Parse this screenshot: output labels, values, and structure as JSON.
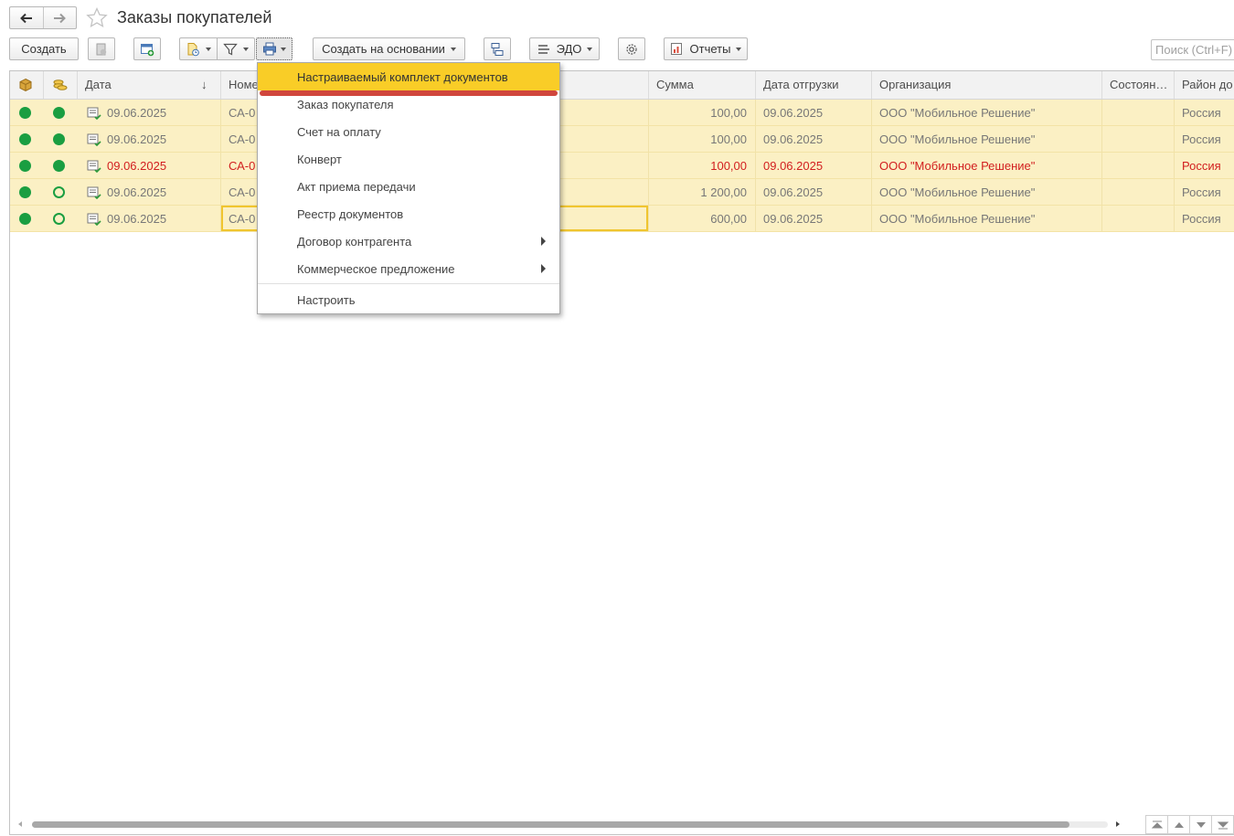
{
  "header": {
    "title": "Заказы покупателей",
    "back_icon": "arrow-left-icon",
    "forward_icon": "arrow-right-icon",
    "favorite_icon": "star-icon"
  },
  "toolbar": {
    "create_label": "Создать",
    "create_based_label": "Создать на основании",
    "edo_label": "ЭДО",
    "reports_label": "Отчеты",
    "search_placeholder": "Поиск (Ctrl+F)"
  },
  "columns": {
    "date": "Дата",
    "number": "Номе",
    "sum": "Сумма",
    "ship_date": "Дата отгрузки",
    "org": "Организация",
    "state": "Состоян…",
    "region": "Район до"
  },
  "sort_indicator": "↓",
  "rows": [
    {
      "status1": "full",
      "status2": "full",
      "date": "09.06.2025",
      "number": "СА-0",
      "sum": "100,00",
      "ship_date": "09.06.2025",
      "org": "ООО \"Мобильное Решение\"",
      "region": "Россия",
      "highlight": false
    },
    {
      "status1": "full",
      "status2": "full",
      "date": "09.06.2025",
      "number": "СА-0",
      "sum": "100,00",
      "ship_date": "09.06.2025",
      "org": "ООО \"Мобильное Решение\"",
      "region": "Россия",
      "highlight": false
    },
    {
      "status1": "full",
      "status2": "full",
      "date": "09.06.2025",
      "number": "СА-0",
      "sum": "100,00",
      "ship_date": "09.06.2025",
      "org": "ООО \"Мобильное Решение\"",
      "region": "Россия",
      "highlight": true
    },
    {
      "status1": "full",
      "status2": "ring",
      "date": "09.06.2025",
      "number": "СА-0",
      "sum": "1 200,00",
      "ship_date": "09.06.2025",
      "org": "ООО \"Мобильное Решение\"",
      "region": "Россия",
      "highlight": false
    },
    {
      "status1": "full",
      "status2": "ring",
      "date": "09.06.2025",
      "number": "СА-0",
      "sum": "600,00",
      "ship_date": "09.06.2025",
      "org": "ООО \"Мобильное Решение\"",
      "region": "Россия",
      "highlight": false
    }
  ],
  "print_menu": {
    "items": [
      {
        "label": "Настраиваемый комплект документов",
        "active": true,
        "submenu": false
      },
      {
        "label": "Заказ покупателя",
        "active": false,
        "submenu": false
      },
      {
        "label": "Счет на оплату",
        "active": false,
        "submenu": false
      },
      {
        "label": "Конверт",
        "active": false,
        "submenu": false
      },
      {
        "label": "Акт приема передачи",
        "active": false,
        "submenu": false
      },
      {
        "label": "Реестр документов",
        "active": false,
        "submenu": false
      },
      {
        "label": "Договор контрагента",
        "active": false,
        "submenu": true
      },
      {
        "label": "Коммерческое предложение",
        "active": false,
        "submenu": true
      }
    ],
    "settings_label": "Настроить"
  },
  "colors": {
    "row_bg": "#fbf0c4",
    "menu_active": "#f9cd27",
    "status_green": "#1a9e41",
    "highlight_text": "#d21f1f",
    "annotation_mark": "#d0463d"
  }
}
